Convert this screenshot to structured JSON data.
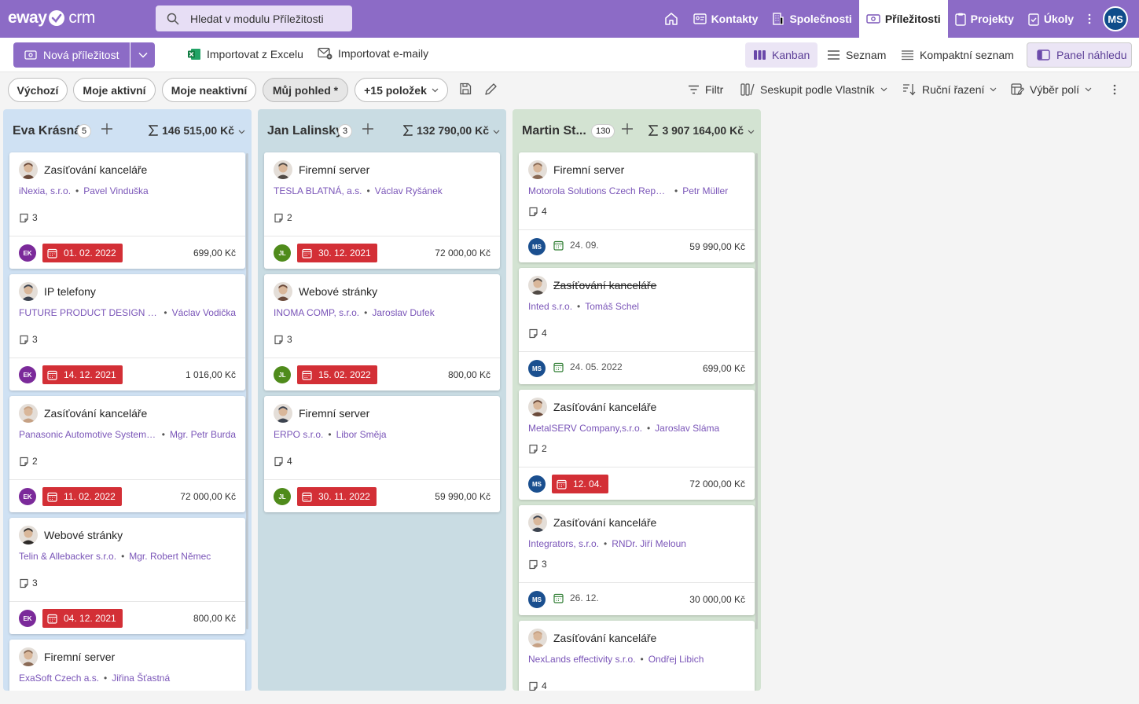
{
  "app": {
    "logo_main": "eway",
    "logo_suffix": "crm",
    "search_placeholder": "Hledat v modulu Příležitosti"
  },
  "nav": {
    "items": [
      {
        "label": "Kontakty",
        "icon": "contact-card-icon"
      },
      {
        "label": "Společnosti",
        "icon": "building-icon"
      },
      {
        "label": "Příležitosti",
        "icon": "money-icon",
        "active": true
      },
      {
        "label": "Projekty",
        "icon": "clipboard-icon"
      },
      {
        "label": "Úkoly",
        "icon": "task-icon"
      }
    ],
    "user_initials": "MS"
  },
  "toolbar": {
    "new_label": "Nová příležitost",
    "import_excel": "Importovat z Excelu",
    "import_email": "Importovat e-maily",
    "view_kanban": "Kanban",
    "view_list": "Seznam",
    "view_compact": "Kompaktní seznam",
    "preview_panel": "Panel náhledu"
  },
  "filters": {
    "pills": [
      "Výchozí",
      "Moje aktivní",
      "Moje neaktivní",
      "Můj pohled *",
      "+15 položek"
    ],
    "filter": "Filtr",
    "group_by": "Seskupit podle Vlastník",
    "sort": "Ruční řazení",
    "fields": "Výběr polí"
  },
  "colors": {
    "brand": "#8c6bc6",
    "danger": "#d32f36",
    "col_eva": "#cfe1f3",
    "col_jan": "#c9dce3",
    "col_martin": "#d3e3d2"
  },
  "columns": [
    {
      "name": "Eva Krásná",
      "count": "5",
      "sum": "146 515,00 Kč",
      "cards": [
        {
          "title": "Zasíťování kanceláře",
          "company": "iNexia, s.r.o.",
          "person": "Pavel Vinduška",
          "notes": "3",
          "owner": "EK",
          "date": "01. 02. 2022",
          "overdue": true,
          "amount": "699,00 Kč"
        },
        {
          "title": "IP telefony",
          "company": "FUTURE PRODUCT DESIGN akciová společnost",
          "person": "Václav Vodička",
          "notes": "3",
          "owner": "EK",
          "date": "14. 12. 2021",
          "overdue": true,
          "amount": "1 016,00 Kč"
        },
        {
          "title": "Zasíťování kanceláře",
          "company": "Panasonic Automotive Systems Czech",
          "person": "Mgr. Petr Burda",
          "notes": "2",
          "owner": "EK",
          "date": "11. 02. 2022",
          "overdue": true,
          "amount": "72 000,00 Kč"
        },
        {
          "title": "Webové stránky",
          "company": "Telin & Allebacker s.r.o.",
          "person": "Mgr. Robert Němec",
          "notes": "3",
          "owner": "EK",
          "date": "04. 12. 2021",
          "overdue": true,
          "amount": "800,00 Kč"
        },
        {
          "title": "Firemní server",
          "company": "ExaSoft Czech a.s.",
          "person": "Jiřina Šťastná",
          "notes": "",
          "owner": "",
          "date": "",
          "overdue": false,
          "amount": ""
        }
      ]
    },
    {
      "name": "Jan Lalinsky",
      "count": "3",
      "sum": "132 790,00 Kč",
      "cards": [
        {
          "title": "Firemní server",
          "company": "TESLA BLATNÁ, a.s.",
          "person": "Václav Ryšánek",
          "notes": "2",
          "owner": "JL",
          "date": "30. 12. 2021",
          "overdue": true,
          "amount": "72 000,00 Kč"
        },
        {
          "title": "Webové stránky",
          "company": "INOMA COMP, s.r.o.",
          "person": "Jaroslav Dufek",
          "notes": "3",
          "owner": "JL",
          "date": "15. 02. 2022",
          "overdue": true,
          "amount": "800,00 Kč"
        },
        {
          "title": "Firemní server",
          "company": "ERPO s.r.o.",
          "person": "Libor Směja",
          "notes": "4",
          "owner": "JL",
          "date": "30. 11. 2022",
          "overdue": true,
          "amount": "59 990,00 Kč"
        }
      ]
    },
    {
      "name": "Martin St...",
      "count": "130",
      "sum": "3 907 164,00 Kč",
      "cards": [
        {
          "title": "Firemní server",
          "company": "Motorola Solutions Czech Republic s.r.o.",
          "person": "Petr Müller",
          "notes": "4",
          "owner": "MS",
          "date": "24. 09.",
          "overdue": false,
          "amount": "59 990,00 Kč"
        },
        {
          "title": "Zasíťování kanceláře",
          "company": "Inted s.r.o.",
          "person": "Tomáš Schel",
          "notes": "4",
          "owner": "MS",
          "date": "24. 05. 2022",
          "overdue": false,
          "amount": "699,00 Kč",
          "strike": true
        },
        {
          "title": "Zasíťování kanceláře",
          "company": "MetalSERV Company,s.r.o.",
          "person": "Jaroslav Sláma",
          "notes": "2",
          "owner": "MS",
          "date": "12. 04.",
          "overdue": true,
          "amount": "72 000,00 Kč"
        },
        {
          "title": "Zasíťování kanceláře",
          "company": "Integrators, s.r.o.",
          "person": "RNDr. Jiří Meloun",
          "notes": "3",
          "owner": "MS",
          "date": "26. 12.",
          "overdue": false,
          "amount": "30 000,00 Kč"
        },
        {
          "title": "Zasíťování kanceláře",
          "company": "NexLands effectivity s.r.o.",
          "person": "Ondřej Libich",
          "notes": "4",
          "owner": "",
          "date": "",
          "overdue": false,
          "amount": ""
        }
      ]
    }
  ]
}
